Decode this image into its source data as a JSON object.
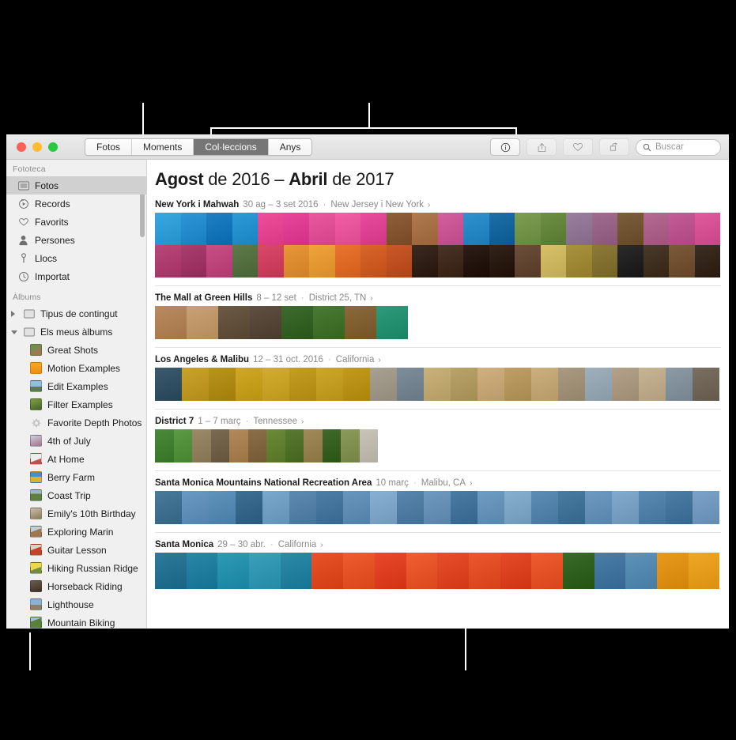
{
  "window": {
    "traffic_lights": [
      "close",
      "minimize",
      "zoom"
    ],
    "colors": {
      "close": "#ff5f57",
      "minimize": "#febc2e",
      "zoom": "#28c840",
      "selected_row": "#d0d0d0",
      "active_segment": "#767676"
    }
  },
  "toolbar": {
    "segments": [
      {
        "label": "Fotos",
        "active": false
      },
      {
        "label": "Moments",
        "active": false
      },
      {
        "label": "Col·leccions",
        "active": true
      },
      {
        "label": "Anys",
        "active": false
      }
    ],
    "buttons": [
      {
        "name": "info-button",
        "icon": "info-icon",
        "enabled": true
      },
      {
        "name": "share-button",
        "icon": "share-icon",
        "enabled": false
      },
      {
        "name": "favorite-button",
        "icon": "heart-icon",
        "enabled": false
      },
      {
        "name": "rotate-button",
        "icon": "rotate-icon",
        "enabled": false
      }
    ],
    "search": {
      "placeholder": "Buscar",
      "value": "",
      "icon": "search-icon"
    }
  },
  "sidebar": {
    "sections": [
      {
        "title": "Fototeca",
        "items": [
          {
            "label": "Fotos",
            "icon": "photos-icon",
            "selected": true
          },
          {
            "label": "Records",
            "icon": "memories-icon",
            "selected": false
          },
          {
            "label": "Favorits",
            "icon": "heart-icon",
            "selected": false
          },
          {
            "label": "Persones",
            "icon": "person-icon",
            "selected": false
          },
          {
            "label": "Llocs",
            "icon": "pin-icon",
            "selected": false
          },
          {
            "label": "Importat",
            "icon": "clock-icon",
            "selected": false
          }
        ]
      },
      {
        "title": "Àlbums",
        "items": [
          {
            "label": "Tipus de contingut",
            "icon": "folder-icon",
            "group": true,
            "expanded": false
          },
          {
            "label": "Els meus àlbums",
            "icon": "folder-icon",
            "group": true,
            "expanded": true
          },
          {
            "label": "Great Shots",
            "icon": "album-thumb",
            "thumb": "#8a7560"
          },
          {
            "label": "Motion Examples",
            "icon": "album-thumb",
            "thumb": "#f5a623"
          },
          {
            "label": "Edit Examples",
            "icon": "album-thumb",
            "thumb": "#6f93b5"
          },
          {
            "label": "Filter Examples",
            "icon": "album-thumb",
            "thumb": "#5f7c3a"
          },
          {
            "label": "Favorite Depth Photos",
            "icon": "gear-icon",
            "thumb": "#bdbdbd"
          },
          {
            "label": "4th of July",
            "icon": "album-thumb",
            "thumb": "#9aa7bb"
          },
          {
            "label": "At Home",
            "icon": "album-thumb",
            "thumb": "#d8d2c8"
          },
          {
            "label": "Berry Farm",
            "icon": "album-thumb",
            "thumb": "#3f6fa8"
          },
          {
            "label": "Coast Trip",
            "icon": "album-thumb",
            "thumb": "#5d7a4e"
          },
          {
            "label": "Emily's 10th Birthday",
            "icon": "album-thumb",
            "thumb": "#c9b9a4"
          },
          {
            "label": "Exploring Marin",
            "icon": "album-thumb",
            "thumb": "#a88f6d"
          },
          {
            "label": "Guitar Lesson",
            "icon": "album-thumb",
            "thumb": "#c2502f"
          },
          {
            "label": "Hiking Russian Ridge",
            "icon": "album-thumb",
            "thumb": "#e0c94a"
          },
          {
            "label": "Horseback Riding",
            "icon": "album-thumb",
            "thumb": "#6b5a4a"
          },
          {
            "label": "Lighthouse",
            "icon": "album-thumb",
            "thumb": "#77a3c4"
          },
          {
            "label": "Mountain Biking",
            "icon": "album-thumb",
            "thumb": "#5a7a3f"
          }
        ]
      }
    ]
  },
  "main": {
    "title_parts": [
      {
        "text": "Agost",
        "bold": true
      },
      {
        "text": " de 2016 – ",
        "bold": false
      },
      {
        "text": "Abril",
        "bold": true
      },
      {
        "text": " de 2017",
        "bold": false
      }
    ],
    "title_plain": "Agost de 2016 – Abril de 2017",
    "collections": [
      {
        "name": "New York i Mahwah",
        "date": "30 ag – 3 set 2016",
        "place": "New Jersey i New York",
        "chevron": "›",
        "rows": 2,
        "photo_count": 44
      },
      {
        "name": "The Mall at Green Hills",
        "date": "8 – 12 set",
        "place": "District 25, TN",
        "chevron": "›",
        "rows": 1,
        "photo_count": 8
      },
      {
        "name": "Los Angeles & Malibu",
        "date": "12 – 31 oct. 2016",
        "place": "California",
        "chevron": "›",
        "rows": 1,
        "photo_count": 21
      },
      {
        "name": "District 7",
        "date": "1 – 7 març",
        "place": "Tennessee",
        "chevron": "›",
        "rows": 1,
        "photo_count": 7
      },
      {
        "name": "Santa Monica Mountains National Recreation Area",
        "date": "10 març",
        "place": "Malibu, CA",
        "chevron": "›",
        "rows": 1,
        "photo_count": 21
      },
      {
        "name": "Santa Monica",
        "date": "29 – 30 abr.",
        "place": "California",
        "chevron": "›",
        "rows": 1,
        "photo_count": 18
      }
    ]
  },
  "palettes": {
    "nyc_row1": [
      "#3aa7e0",
      "#2e96d6",
      "#1f7fc4",
      "#2e9ad8",
      "#ef4f9a",
      "#e8469a",
      "#ea59a0",
      "#f25fa6",
      "#e84c9c",
      "#8e5f3a",
      "#b07a50",
      "#d45f9e",
      "#2f92cf",
      "#1e6fa8",
      "#7d9e52",
      "#6d8f45",
      "#9a7f9e",
      "#a06c8f",
      "#7b5f3c",
      "#b46a92",
      "#c45c97",
      "#e05a9e"
    ],
    "nyc_row2": [
      "#b8477a",
      "#a83f6e",
      "#c84f85",
      "#5e7a4a",
      "#d94a6a",
      "#e8963a",
      "#f0a33c",
      "#e8742f",
      "#d8652c",
      "#c9582a",
      "#3a2a22",
      "#4a3428",
      "#2e2018",
      "#33241b",
      "#6b4f3a",
      "#d7c06a",
      "#a8923f",
      "#8c7a3a",
      "#2b2b2b",
      "#4a3a2a",
      "#7a5a3a",
      "#3d2f24"
    ],
    "mall": [
      "#b98b5e",
      "#c9a173",
      "#6b5a46",
      "#5f5042",
      "#3e6b2e",
      "#4a7a33",
      "#8a6a3a",
      "#2f9a7a"
    ],
    "la": [
      "#3c5a6e",
      "#c8a22c",
      "#b8941f",
      "#cfa826",
      "#d3ad2f",
      "#c49d24",
      "#cda72b",
      "#c29a20",
      "#a8a090",
      "#7d8e9a",
      "#c9b27a",
      "#b9a36a",
      "#d0b07f",
      "#be9f66",
      "#cbb07d",
      "#a99a80",
      "#9fb0bd",
      "#b3a189",
      "#c6b493",
      "#8c9aa5",
      "#7a6f60"
    ],
    "d7": [
      "#4a8a3a",
      "#5d9a45",
      "#9a8a6a",
      "#7a6a52",
      "#b08a5a",
      "#8a6f4a",
      "#6b8a3a",
      "#5a7a33",
      "#a08a5a",
      "#3f6a2a",
      "#8a9a5a",
      "#c9c4b8"
    ],
    "smm": [
      "#4a7a9a",
      "#6a9ac4",
      "#5f93bc",
      "#3f6f92",
      "#7aa8cc",
      "#5d8ab0",
      "#4e7ea6",
      "#6896bd",
      "#87b0d2",
      "#5a86ae",
      "#7099c0",
      "#4b7ba3",
      "#6f9cc3",
      "#86aecf",
      "#5d8cb4",
      "#4a7ba0",
      "#6e9ac2",
      "#82aacd",
      "#5a89b1",
      "#4d7da4",
      "#7ba2c8"
    ],
    "sm": [
      "#2e7a9a",
      "#2b87a8",
      "#2f9ab5",
      "#3aa0bb",
      "#2d8aa8",
      "#e8532a",
      "#ee5c2f",
      "#e8492a",
      "#f05e33",
      "#e74e2b",
      "#ed5730",
      "#e54a29",
      "#ef5c31",
      "#3a6a2a",
      "#4a7ea8",
      "#5d93bb",
      "#e89a1f",
      "#f0a626"
    ]
  }
}
